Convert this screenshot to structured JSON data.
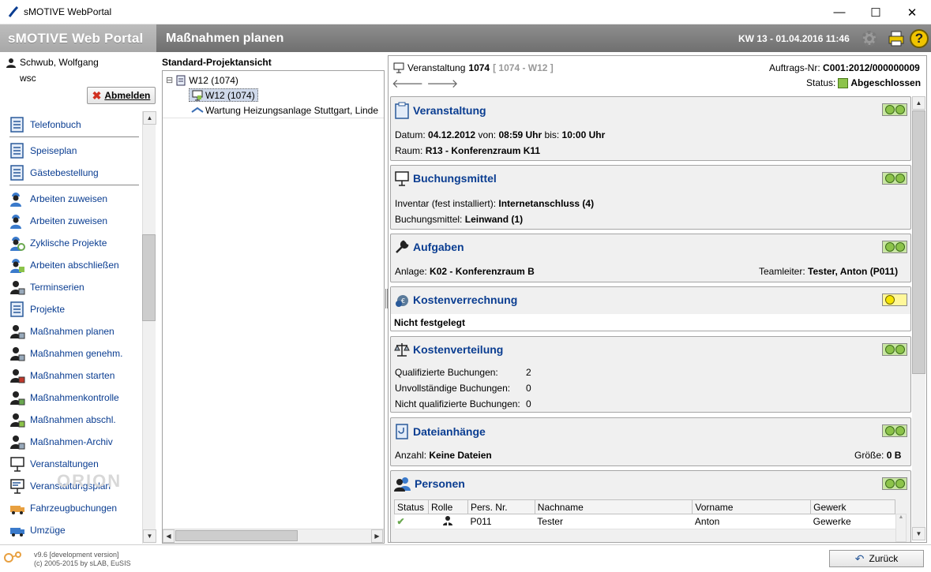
{
  "window": {
    "title": "sMOTIVE WebPortal",
    "minimize": "—",
    "maximize": "☐",
    "close": "✕"
  },
  "header": {
    "brand": "sMOTIVE Web Portal",
    "page_title": "Maßnahmen planen",
    "datetime": "KW 13 - 01.04.2016 11:46",
    "help": "?"
  },
  "user": {
    "name": "Schwub, Wolfgang",
    "login": "wsc",
    "logout_label": "Abmelden"
  },
  "nav": {
    "items": [
      {
        "label": "Telefonbuch",
        "icon": "phonebook-icon"
      },
      {
        "label": "Speiseplan",
        "icon": "menu-plan-icon"
      },
      {
        "label": "Gästebestellung",
        "icon": "guest-order-icon"
      },
      {
        "label": "Arbeiten zuweisen",
        "icon": "worker-icon"
      },
      {
        "label": "Arbeiten zuweisen",
        "icon": "worker-icon"
      },
      {
        "label": "Zyklische Projekte",
        "icon": "cyclic-project-icon"
      },
      {
        "label": "Arbeiten abschließen",
        "icon": "worker-done-icon"
      },
      {
        "label": "Terminserien",
        "icon": "appointment-series-icon"
      },
      {
        "label": "Projekte",
        "icon": "projects-icon"
      },
      {
        "label": "Maßnahmen planen",
        "icon": "measure-plan-icon"
      },
      {
        "label": "Maßnahmen genehm.",
        "icon": "measure-approve-icon"
      },
      {
        "label": "Maßnahmen starten",
        "icon": "measure-start-icon"
      },
      {
        "label": "Maßnahmenkontrolle",
        "icon": "measure-control-icon"
      },
      {
        "label": "Maßnahmen abschl.",
        "icon": "measure-close-icon"
      },
      {
        "label": "Maßnahmen-Archiv",
        "icon": "measure-archive-icon"
      },
      {
        "label": "Veranstaltungen",
        "icon": "event-icon"
      },
      {
        "label": "Veranstaltungsplan",
        "icon": "event-plan-icon"
      },
      {
        "label": "Fahrzeugbuchungen",
        "icon": "vehicle-icon"
      },
      {
        "label": "Umzüge",
        "icon": "moving-truck-icon"
      }
    ]
  },
  "footer": {
    "version": "v9.6 [development version]",
    "copyright": "(c) 2005-2015 by sLAB, EuSIS",
    "back_label": "Zurück",
    "logo_text": "ORION"
  },
  "tree": {
    "header": "Standard-Projektansicht",
    "expander": "⊟",
    "nodes": [
      {
        "label": "W12 (1074)",
        "level": 0
      },
      {
        "label": "W12 (1074)",
        "level": 1,
        "selected": true
      },
      {
        "label": "Wartung Heizungsanlage Stuttgart, Linde",
        "level": 1
      }
    ]
  },
  "detail": {
    "title_prefix": "Veranstaltung",
    "title_number": "1074",
    "title_ref": "[ 1074 - W12 ]",
    "auftrag_label": "Auftrags-Nr:",
    "auftrag_value": "C001:2012/000000009",
    "status_label": "Status:",
    "status_value": "Abgeschlossen",
    "status_color": "#8cc34a",
    "nav_back": "🡐",
    "nav_forward": "🡒",
    "cards": {
      "veranstaltung": {
        "title": "Veranstaltung",
        "datum_label": "Datum:",
        "datum": "04.12.2012",
        "von_label": "von:",
        "von": "08:59 Uhr",
        "bis_label": "bis:",
        "bis": "10:00 Uhr",
        "raum_label": "Raum:",
        "raum": "R13 - Konferenzraum K11",
        "status": "green"
      },
      "buchungsmittel": {
        "title": "Buchungsmittel",
        "inventar_label": "Inventar (fest installiert):",
        "inventar": "Internetanschluss (4)",
        "bm_label": "Buchungsmittel:",
        "bm": "Leinwand (1)",
        "status": "green"
      },
      "aufgaben": {
        "title": "Aufgaben",
        "anlage_label": "Anlage:",
        "anlage": "K02 - Konferenzraum B",
        "teamleiter_label": "Teamleiter:",
        "teamleiter": "Tester, Anton (P011)",
        "status": "green"
      },
      "kostenverrechnung": {
        "title": "Kostenverrechnung",
        "text": "Nicht festgelegt",
        "status": "yellow"
      },
      "kostenverteilung": {
        "title": "Kostenverteilung",
        "q_label": "Qualifizierte Buchungen:",
        "q": "2",
        "u_label": "Unvollständige Buchungen:",
        "u": "0",
        "n_label": "Nicht qualifizierte Buchungen:",
        "n": "0",
        "status": "green"
      },
      "dateianhaenge": {
        "title": "Dateianhänge",
        "anzahl_label": "Anzahl:",
        "anzahl": "Keine Dateien",
        "groesse_label": "Größe:",
        "groesse": "0 B",
        "status": "green"
      },
      "personen": {
        "title": "Personen",
        "status": "green",
        "columns": [
          "Status",
          "Rolle",
          "Pers. Nr.",
          "Nachname",
          "Vorname",
          "Gewerk"
        ],
        "rows": [
          {
            "status": "✔",
            "rolle": "person-icon",
            "persnr": "P011",
            "nachname": "Tester",
            "vorname": "Anton",
            "gewerk": "Gewerke"
          }
        ]
      }
    }
  }
}
